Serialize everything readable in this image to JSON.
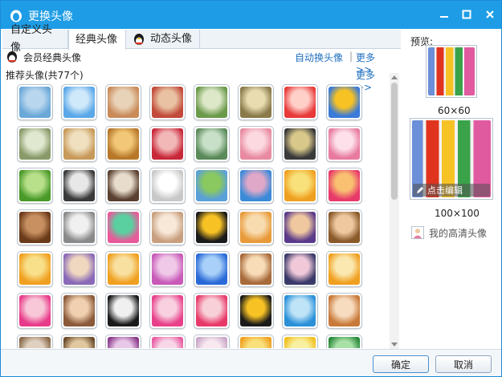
{
  "window": {
    "title": "更换头像",
    "controls": {
      "minimize": "minimize-icon",
      "maximize": "maximize-icon",
      "close": "close-icon"
    }
  },
  "tabs": [
    {
      "label": "自定义头像",
      "active": false
    },
    {
      "label": "经典头像",
      "active": true
    },
    {
      "label": "动态头像",
      "active": false
    }
  ],
  "header": {
    "vip_label": "会员经典头像",
    "auto_change": "自动换头像",
    "separator": "|",
    "more": "更多>>",
    "recommended": "推荐头像(共77个)",
    "more2": "更多>>"
  },
  "avatars": [
    [
      "#6aa8d8",
      "#b8d6ee"
    ],
    [
      "#5aa8e8",
      "#cfe8fa"
    ],
    [
      "#c98b5a",
      "#e9d3b8"
    ],
    [
      "#c24a3a",
      "#e8c2a2"
    ],
    [
      "#6b9a4a",
      "#dde8c8"
    ],
    [
      "#8a7a4a",
      "#e8dcb0"
    ],
    [
      "#e83a3a",
      "#ffd0c8"
    ],
    [
      "#3a7ad8",
      "#f7c224"
    ],
    [
      "#8a9a6a",
      "#e0e8d0"
    ],
    [
      "#c89a5a",
      "#f0e0c0"
    ],
    [
      "#b8782a",
      "#f2c878"
    ],
    [
      "#c8283a",
      "#f2b8b8"
    ],
    [
      "#5a8a5a",
      "#c8e0c8"
    ],
    [
      "#e88aa0",
      "#fcd8e0"
    ],
    [
      "#3a3a3a",
      "#d8c88a"
    ],
    [
      "#e87aa0",
      "#fde0ea"
    ],
    [
      "#4a9a2a",
      "#b8e08a"
    ],
    [
      "#3a3a3a",
      "#e8e8e8"
    ],
    [
      "#5a4030",
      "#e8dccc"
    ],
    [
      "#c8c8c8",
      "#ffffff"
    ],
    [
      "#5aa0d8",
      "#8ac860"
    ],
    [
      "#3a8ad8",
      "#e0a8c8"
    ],
    [
      "#f0a020",
      "#f8e07a"
    ],
    [
      "#e83a6a",
      "#f8c070"
    ],
    [
      "#6a3a1a",
      "#c89060"
    ],
    [
      "#8a8a8a",
      "#f0f0f0"
    ],
    [
      "#e85a9a",
      "#5ad0a0"
    ],
    [
      "#c8a080",
      "#f8e8d8"
    ],
    [
      "#1a1a1a",
      "#f7c224"
    ],
    [
      "#e89a3a",
      "#f8dcb0"
    ],
    [
      "#5a3a8a",
      "#f0c8a0"
    ],
    [
      "#8a5a2a",
      "#f0c8a0"
    ],
    [
      "#f0a020",
      "#f8e08a"
    ],
    [
      "#8a6ab8",
      "#f0d8c0"
    ],
    [
      "#f0a020",
      "#f8e0a0"
    ],
    [
      "#c85ab8",
      "#f0c8e8"
    ],
    [
      "#2a6ad8",
      "#a8d0f8"
    ],
    [
      "#a86a3a",
      "#f8dcb8"
    ],
    [
      "#3a3a6a",
      "#f0c8d8"
    ],
    [
      "#f0a020",
      "#fae8b0"
    ],
    [
      "#e83a8a",
      "#f8c8d8"
    ],
    [
      "#8a5a3a",
      "#f0d0b0"
    ],
    [
      "#1a1a1a",
      "#f0f0f0"
    ],
    [
      "#e8408a",
      "#f8d0e0"
    ],
    [
      "#e83a6a",
      "#f8d0d8"
    ],
    [
      "#1a1a1a",
      "#f7c224"
    ],
    [
      "#2a90d8",
      "#bfe4f8"
    ],
    [
      "#c87a3a",
      "#f8dcc0"
    ],
    [
      "#8a6a4a",
      "#e0d0c0"
    ],
    [
      "#6a4a2a",
      "#e0c8a0"
    ],
    [
      "#8a3a8a",
      "#e8c8e8"
    ],
    [
      "#e85aa0",
      "#f8d8e8"
    ],
    [
      "#c8a8c8",
      "#f8e8f0"
    ],
    [
      "#f0a020",
      "#f8e07a"
    ],
    [
      "#f0c020",
      "#f8f0a0"
    ],
    [
      "#2a8a3a",
      "#a8e0a8"
    ]
  ],
  "preview": {
    "label": "预览:",
    "small_size": "60×60",
    "edit_label": "点击编辑",
    "large_size": "100×100",
    "hd_label": "我的高清头像"
  },
  "footer": {
    "ok": "确定",
    "cancel": "取消"
  }
}
